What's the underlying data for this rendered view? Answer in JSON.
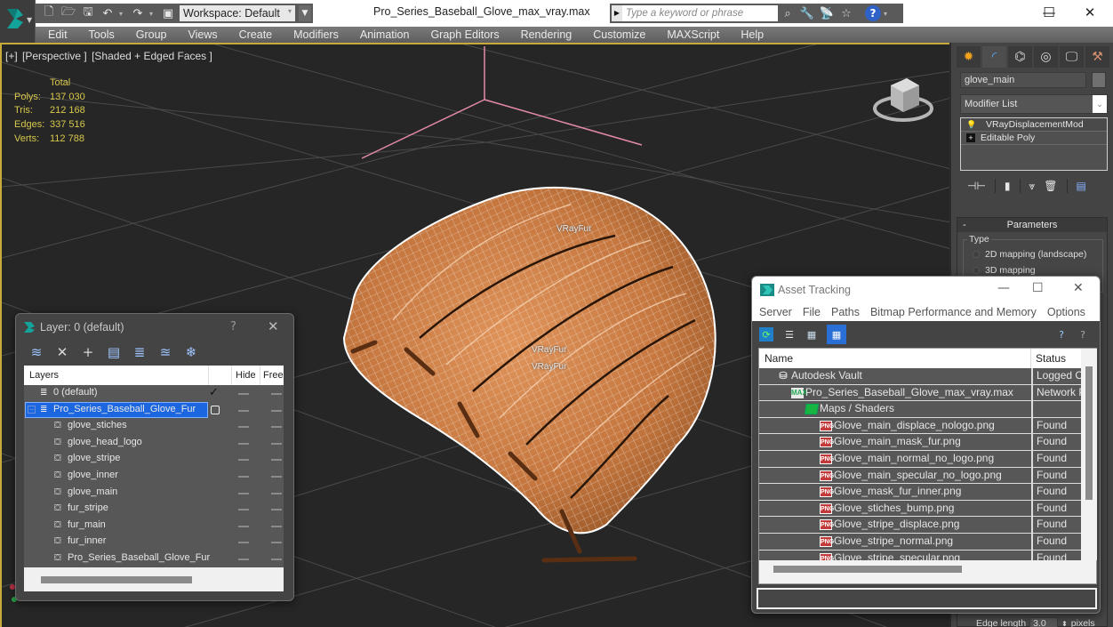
{
  "window": {
    "title": "Pro_Series_Baseball_Glove_max_vray.max",
    "controls": {
      "minimize": "—",
      "maximize": "☐",
      "close": "✕"
    }
  },
  "quick_access": {
    "workspace": "Workspace: Default",
    "search_placeholder": "Type a keyword or phrase",
    "help": "?"
  },
  "menu": [
    "Edit",
    "Tools",
    "Group",
    "Views",
    "Create",
    "Modifiers",
    "Animation",
    "Graph Editors",
    "Rendering",
    "Customize",
    "MAXScript",
    "Help"
  ],
  "viewport": {
    "label_parts": [
      "[+]",
      "[Perspective ]",
      "[Shaded + Edged Faces ]"
    ],
    "stats": {
      "header": "Total",
      "rows": [
        {
          "key": "Polys:",
          "value": "137 030"
        },
        {
          "key": "Tris:",
          "value": "212 168"
        },
        {
          "key": "Edges:",
          "value": "337 516"
        },
        {
          "key": "Verts:",
          "value": "112 788"
        }
      ]
    },
    "helper_labels": [
      "VRayFur",
      "VRayFur",
      "VRayFur"
    ],
    "colors": {
      "border": "#c8aa3a",
      "stats_text": "#d8c84a",
      "grid": "#5a5a5a",
      "axis": "#e07a9a",
      "glove": "#c87a3e"
    }
  },
  "command_panel": {
    "object_name": "glove_main",
    "modifier_list": "Modifier List",
    "stack": [
      "VRayDisplacementMod",
      "Editable Poly"
    ],
    "parameters": {
      "title": "Parameters",
      "collapse": "-",
      "type_label": "Type",
      "options": [
        "2D mapping (landscape)",
        "3D mapping"
      ]
    },
    "edge_length": {
      "label": "Edge length",
      "value": "3.0",
      "unit": "pixels"
    }
  },
  "layer_dialog": {
    "title": "Layer: 0 (default)",
    "help": "?",
    "close": "✕",
    "columns": [
      "Layers",
      "",
      "Hide",
      "Freeze"
    ],
    "rows": [
      {
        "name": "0 (default)",
        "type": "layer",
        "level": 0,
        "current": true
      },
      {
        "name": "Pro_Series_Baseball_Glove_Fur",
        "type": "layer",
        "level": 0,
        "selected": true
      },
      {
        "name": "glove_stiches",
        "type": "object",
        "level": 1
      },
      {
        "name": "glove_head_logo",
        "type": "object",
        "level": 1
      },
      {
        "name": "glove_stripe",
        "type": "object",
        "level": 1
      },
      {
        "name": "glove_inner",
        "type": "object",
        "level": 1
      },
      {
        "name": "glove_main",
        "type": "object",
        "level": 1
      },
      {
        "name": "fur_stripe",
        "type": "object",
        "level": 1
      },
      {
        "name": "fur_main",
        "type": "object",
        "level": 1
      },
      {
        "name": "fur_inner",
        "type": "object",
        "level": 1
      },
      {
        "name": "Pro_Series_Baseball_Glove_Fur",
        "type": "object",
        "level": 1
      }
    ]
  },
  "asset_dialog": {
    "title": "Asset Tracking",
    "menu": [
      "Server",
      "File",
      "Paths",
      "Bitmap Performance and Memory",
      "Options"
    ],
    "columns": [
      "Name",
      "Status"
    ],
    "rows": [
      {
        "name": "Autodesk Vault",
        "status": "Logged Out",
        "icon": "vault",
        "level": 0
      },
      {
        "name": "Pro_Series_Baseball_Glove_max_vray.max",
        "status": "Network Path",
        "icon": "maxfile",
        "level": 1
      },
      {
        "name": "Maps / Shaders",
        "status": "",
        "icon": "maps",
        "level": 2
      },
      {
        "name": "Glove_main_displace_nologo.png",
        "status": "Found",
        "icon": "png",
        "level": 3
      },
      {
        "name": "Glove_main_mask_fur.png",
        "status": "Found",
        "icon": "png",
        "level": 3
      },
      {
        "name": "Glove_main_normal_no_logo.png",
        "status": "Found",
        "icon": "png",
        "level": 3
      },
      {
        "name": "Glove_main_specular_no_logo.png",
        "status": "Found",
        "icon": "png",
        "level": 3
      },
      {
        "name": "Glove_mask_fur_inner.png",
        "status": "Found",
        "icon": "png",
        "level": 3
      },
      {
        "name": "Glove_stiches_bump.png",
        "status": "Found",
        "icon": "png",
        "level": 3
      },
      {
        "name": "Glove_stripe_displace.png",
        "status": "Found",
        "icon": "png",
        "level": 3
      },
      {
        "name": "Glove_stripe_normal.png",
        "status": "Found",
        "icon": "png",
        "level": 3
      },
      {
        "name": "Glove_stripe_specular.png",
        "status": "Found",
        "icon": "png",
        "level": 3
      }
    ],
    "path_value": ""
  }
}
